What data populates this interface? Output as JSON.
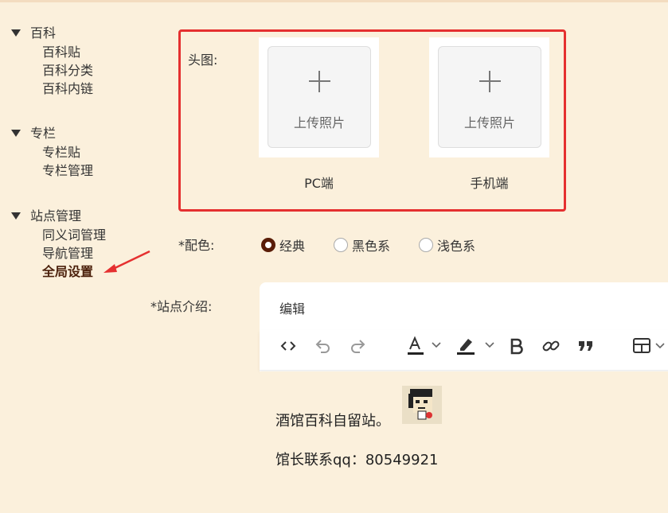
{
  "sidebar": {
    "groups": [
      {
        "title": "百科",
        "items": [
          "百科贴",
          "百科分类",
          "百科内链"
        ]
      },
      {
        "title": "专栏",
        "items": [
          "专栏贴",
          "专栏管理"
        ]
      },
      {
        "title": "站点管理",
        "items": [
          "同义词管理",
          "导航管理",
          "全局设置"
        ]
      }
    ],
    "active_item": "全局设置"
  },
  "form": {
    "header_image": {
      "label": "头图:",
      "upload_text": "上传照片",
      "pc_caption": "PC端",
      "mobile_caption": "手机端"
    },
    "color_scheme": {
      "required_mark": "*",
      "label": "配色:",
      "options": [
        "经典",
        "黑色系",
        "浅色系"
      ],
      "selected": "经典"
    },
    "site_intro": {
      "required_mark": "*",
      "label": "站点介绍:",
      "editor_title": "编辑",
      "toolbar": [
        "code-icon",
        "undo-icon",
        "redo-icon",
        "font-color-icon",
        "highlight-icon",
        "bold-icon",
        "link-icon",
        "quote-icon",
        "table-icon"
      ],
      "content": {
        "line1": "酒馆百科自留站。",
        "line2": "馆长联系qq：80549921"
      }
    }
  },
  "colors": {
    "background": "#fbf0dc",
    "highlight_frame": "#e53030",
    "active_text": "#4a1f0a",
    "radio_checked": "#5a1d08"
  }
}
